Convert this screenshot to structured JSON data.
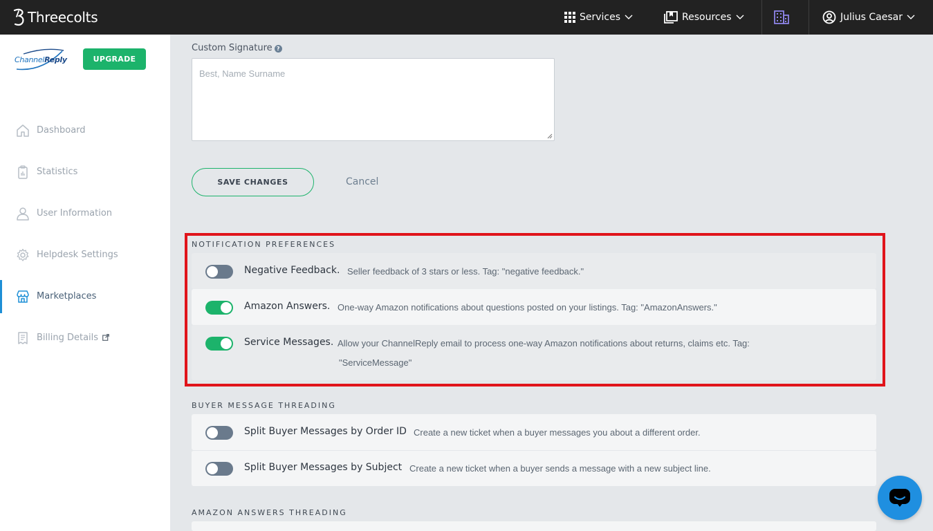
{
  "topbar": {
    "brand": "Threecolts",
    "services_label": "Services",
    "resources_label": "Resources",
    "user_name": "Julius Caesar"
  },
  "sidebar": {
    "logo_text_a": "Channel",
    "logo_text_b": "Reply",
    "upgrade_label": "UPGRADE",
    "items": [
      {
        "label": "Dashboard",
        "icon": "home-icon"
      },
      {
        "label": "Statistics",
        "icon": "clipboard-icon"
      },
      {
        "label": "User Information",
        "icon": "user-icon"
      },
      {
        "label": "Helpdesk Settings",
        "icon": "gear-icon"
      },
      {
        "label": "Marketplaces",
        "icon": "store-icon",
        "active": true
      },
      {
        "label": "Billing Details",
        "icon": "receipt-icon",
        "external": true
      }
    ]
  },
  "signature": {
    "label": "Custom Signature",
    "placeholder": "Best, Name Surname"
  },
  "actions": {
    "save_label": "SAVE CHANGES",
    "cancel_label": "Cancel"
  },
  "notification_preferences": {
    "title": "NOTIFICATION PREFERENCES",
    "items": [
      {
        "title": "Negative Feedback.",
        "desc": "Seller feedback of 3 stars or less. Tag: \"negative feedback.\"",
        "enabled": false
      },
      {
        "title": "Amazon Answers.",
        "desc": "One-way Amazon notifications about questions posted on your listings. Tag: \"AmazonAnswers.\"",
        "enabled": true
      },
      {
        "title": "Service Messages.",
        "desc": "Allow your ChannelReply email to process one-way Amazon notifications about returns, claims etc. Tag:",
        "desc2": "\"ServiceMessage\"",
        "enabled": true
      }
    ]
  },
  "buyer_threading": {
    "title": "BUYER MESSAGE THREADING",
    "items": [
      {
        "title": "Split Buyer Messages by Order ID",
        "desc": "Create a new ticket when a buyer messages you about a different order.",
        "enabled": false
      },
      {
        "title": "Split Buyer Messages by Subject",
        "desc": "Create a new ticket when a buyer sends a message with a new subject line.",
        "enabled": false
      }
    ]
  },
  "amazon_answers_threading": {
    "title": "AMAZON ANSWERS THREADING"
  },
  "colors": {
    "accent_green": "#1cb36b",
    "highlight_red": "#e0141b",
    "chat_blue": "#1f8fe0"
  }
}
